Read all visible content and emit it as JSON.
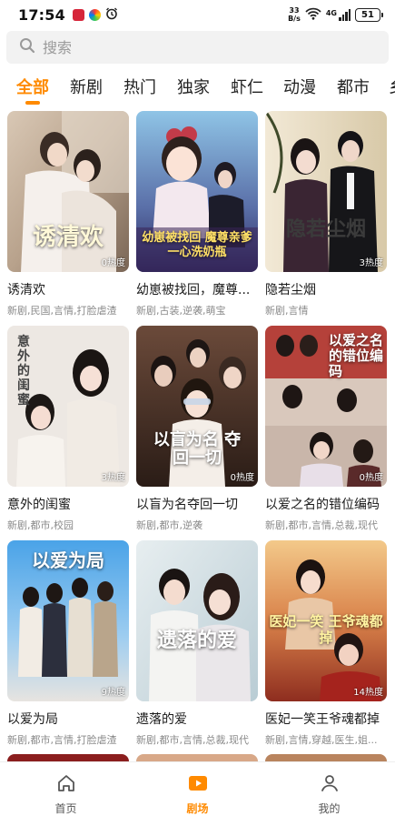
{
  "status_bar": {
    "time": "17:54",
    "net_speed_value": "33",
    "net_speed_unit": "B/s",
    "network_type": "4G",
    "battery": "51"
  },
  "search": {
    "placeholder": "搜索"
  },
  "tabs": [
    {
      "label": "全部",
      "active": true
    },
    {
      "label": "新剧"
    },
    {
      "label": "热门"
    },
    {
      "label": "独家"
    },
    {
      "label": "虾仁"
    },
    {
      "label": "动漫"
    },
    {
      "label": "都市"
    },
    {
      "label": "乡"
    }
  ],
  "dramas": [
    {
      "title": "诱清欢",
      "poster_text": "诱清欢",
      "heat": "0热度",
      "tags": "新剧,民国,言情,打脸虐渣"
    },
    {
      "title": "幼崽被找回，魔尊...",
      "poster_text": "幼崽被找回 魔尊亲爹一心洗奶瓶",
      "heat": "",
      "tags": "新剧,古装,逆袭,萌宝"
    },
    {
      "title": "隐若尘烟",
      "poster_text": "隐若尘烟",
      "heat": "3热度",
      "tags": "新剧,言情"
    },
    {
      "title": "意外的闺蜜",
      "poster_text": "意外的闺蜜",
      "heat": "3热度",
      "tags": "新剧,都市,校园"
    },
    {
      "title": "以盲为名夺回一切",
      "poster_text": "以盲为名 夺回一切",
      "heat": "0热度",
      "tags": "新剧,都市,逆袭"
    },
    {
      "title": "以爱之名的错位编码",
      "poster_text": "以爱之名的错位编码",
      "heat": "0热度",
      "tags": "新剧,都市,言情,总裁,现代"
    },
    {
      "title": "以爱为局",
      "poster_text": "以爱为局",
      "heat": "9热度",
      "tags": "新剧,都市,言情,打脸虐渣"
    },
    {
      "title": "遗落的爱",
      "poster_text": "遗落的爱",
      "heat": "",
      "tags": "新剧,都市,言情,总裁,现代"
    },
    {
      "title": "医妃一笑王爷魂都掉",
      "poster_text": "医妃一笑 王爷魂都掉",
      "heat": "14热度",
      "tags": "新剧,言情,穿越,医生,姐..."
    }
  ],
  "bottom_nav": [
    {
      "label": "首页",
      "icon": "home-icon"
    },
    {
      "label": "剧场",
      "icon": "play-icon",
      "active": true
    },
    {
      "label": "我的",
      "icon": "profile-icon"
    }
  ],
  "colors": {
    "accent": "#ff8a00"
  }
}
